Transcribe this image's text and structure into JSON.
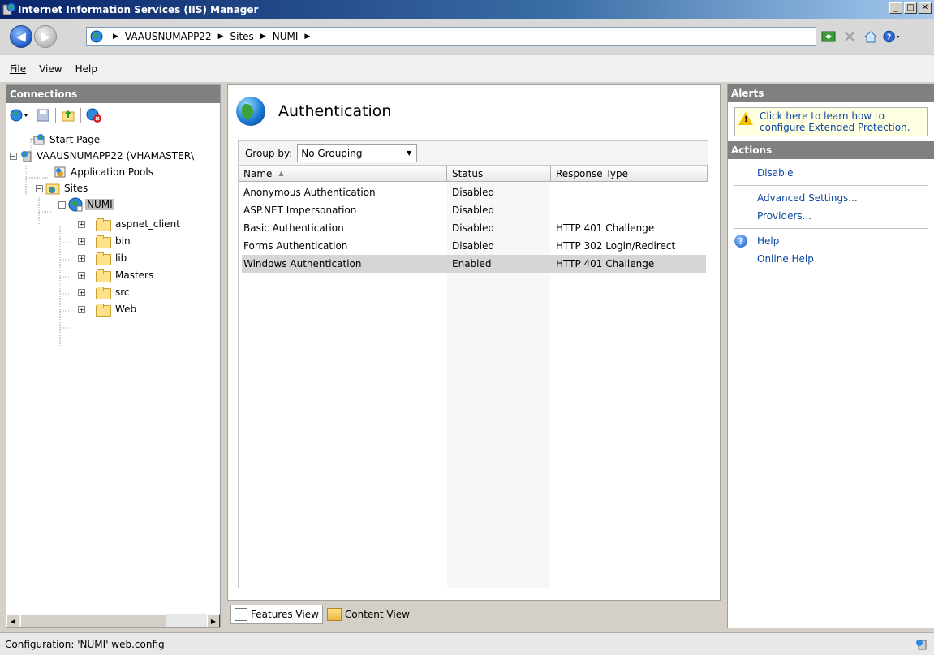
{
  "window": {
    "title": "Internet Information Services (IIS) Manager",
    "buttons": [
      "_",
      "□",
      "✕"
    ]
  },
  "address": {
    "crumbs": [
      "VAAUSNUMAPP22",
      "Sites",
      "NUMI"
    ]
  },
  "menu": {
    "items": [
      "File",
      "View",
      "Help"
    ]
  },
  "connections": {
    "header": "Connections",
    "tree": [
      {
        "label": "Start Page",
        "icon": "start-page-icon"
      },
      {
        "label": "VAAUSNUMAPP22 (VHAMASTER\\",
        "icon": "server-icon",
        "expanded": true
      },
      {
        "label": "Application Pools",
        "icon": "app-pools-icon"
      },
      {
        "label": "Sites",
        "icon": "sites-folder-icon",
        "expanded": true
      },
      {
        "label": "NUMI",
        "icon": "website-globe-icon",
        "expanded": true,
        "selected": true
      },
      {
        "label": "aspnet_client",
        "icon": "folder-icon"
      },
      {
        "label": "bin",
        "icon": "folder-icon"
      },
      {
        "label": "lib",
        "icon": "folder-icon"
      },
      {
        "label": "Masters",
        "icon": "folder-icon"
      },
      {
        "label": "src",
        "icon": "folder-icon"
      },
      {
        "label": "Web",
        "icon": "folder-icon"
      }
    ]
  },
  "feature": {
    "title": "Authentication",
    "group_by_label": "Group by:",
    "group_by_value": "No Grouping",
    "columns": [
      "Name",
      "Status",
      "Response Type"
    ],
    "sort_indicator": "▲",
    "rows": [
      {
        "name": "Anonymous Authentication",
        "status": "Disabled",
        "response": ""
      },
      {
        "name": "ASP.NET Impersonation",
        "status": "Disabled",
        "response": ""
      },
      {
        "name": "Basic Authentication",
        "status": "Disabled",
        "response": "HTTP 401 Challenge"
      },
      {
        "name": "Forms Authentication",
        "status": "Disabled",
        "response": "HTTP 302 Login/Redirect"
      },
      {
        "name": "Windows Authentication",
        "status": "Enabled",
        "response": "HTTP 401 Challenge",
        "selected": true
      }
    ]
  },
  "bottom_tabs": {
    "features_view": "Features View",
    "content_view": "Content View"
  },
  "alerts": {
    "header": "Alerts",
    "message": "Click here to learn how to configure Extended Protection."
  },
  "actions": {
    "header": "Actions",
    "disable": "Disable",
    "advanced": "Advanced Settings...",
    "providers": "Providers...",
    "help": "Help",
    "online_help": "Online Help"
  },
  "status": {
    "text": "Configuration: 'NUMI' web.config"
  }
}
